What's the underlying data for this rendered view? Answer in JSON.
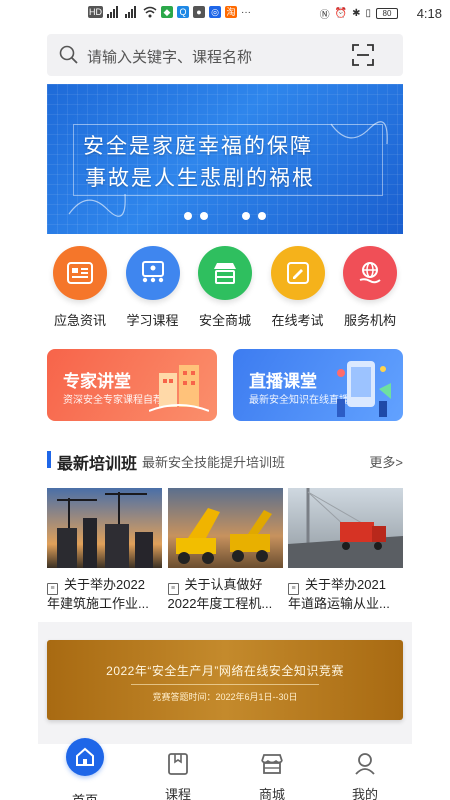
{
  "status_bar": {
    "left_icons": [
      "hd-icon",
      "signal-icon",
      "signal-icon",
      "wifi-icon",
      "app-icon",
      "app-icon",
      "app-icon",
      "app-icon",
      "app-icon"
    ],
    "more": "···",
    "battery": "80",
    "time": "4:18"
  },
  "search": {
    "placeholder": "请输入关键字、课程名称",
    "scan_icon": "scan-icon"
  },
  "banner": {
    "line1": "安全是家庭幸福的保障",
    "line2": "事故是人生悲剧的祸根",
    "bg_color": "#1e6ad8"
  },
  "categories": [
    {
      "label": "应急资讯",
      "icon": "news-icon",
      "color": "#f5762a"
    },
    {
      "label": "学习课程",
      "icon": "classroom-icon",
      "color": "#3f86ef"
    },
    {
      "label": "安全商城",
      "icon": "store-icon",
      "color": "#2fbf5f"
    },
    {
      "label": "在线考试",
      "icon": "exam-icon",
      "color": "#f5b21b"
    },
    {
      "label": "服务机构",
      "icon": "globe-hand-icon",
      "color": "#f04f57"
    }
  ],
  "cards": {
    "expert": {
      "title": "专家讲堂",
      "sub": "资深安全专家课程自荐"
    },
    "live": {
      "title": "直播课堂",
      "sub": "最新安全知识在线直播"
    }
  },
  "section": {
    "title": "最新培训班",
    "subtitle": "最新安全技能提升培训班",
    "more": "更多>"
  },
  "courses": [
    {
      "line1": "关于举办2022",
      "line2": "年建筑施工作业..."
    },
    {
      "line1": "关于认真做好",
      "line2": "2022年度工程机..."
    },
    {
      "line1": "关于举办2021",
      "line2": "年道路运输从业..."
    }
  ],
  "contest": {
    "title": "2022年“安全生产月”网络在线安全知识竞赛",
    "time": "竞赛答题时间：2022年6月1日--30日"
  },
  "bottom_nav": [
    {
      "label": "首页",
      "icon": "home-icon",
      "active": true
    },
    {
      "label": "课程",
      "icon": "bookmark-icon",
      "active": false
    },
    {
      "label": "商城",
      "icon": "store-icon",
      "active": false
    },
    {
      "label": "我的",
      "icon": "profile-icon",
      "active": false
    }
  ],
  "colors": {
    "accent": "#1e66e8",
    "expert_card": "#f7644a",
    "live_card": "#3d7cf0",
    "contest": "#b07418"
  }
}
